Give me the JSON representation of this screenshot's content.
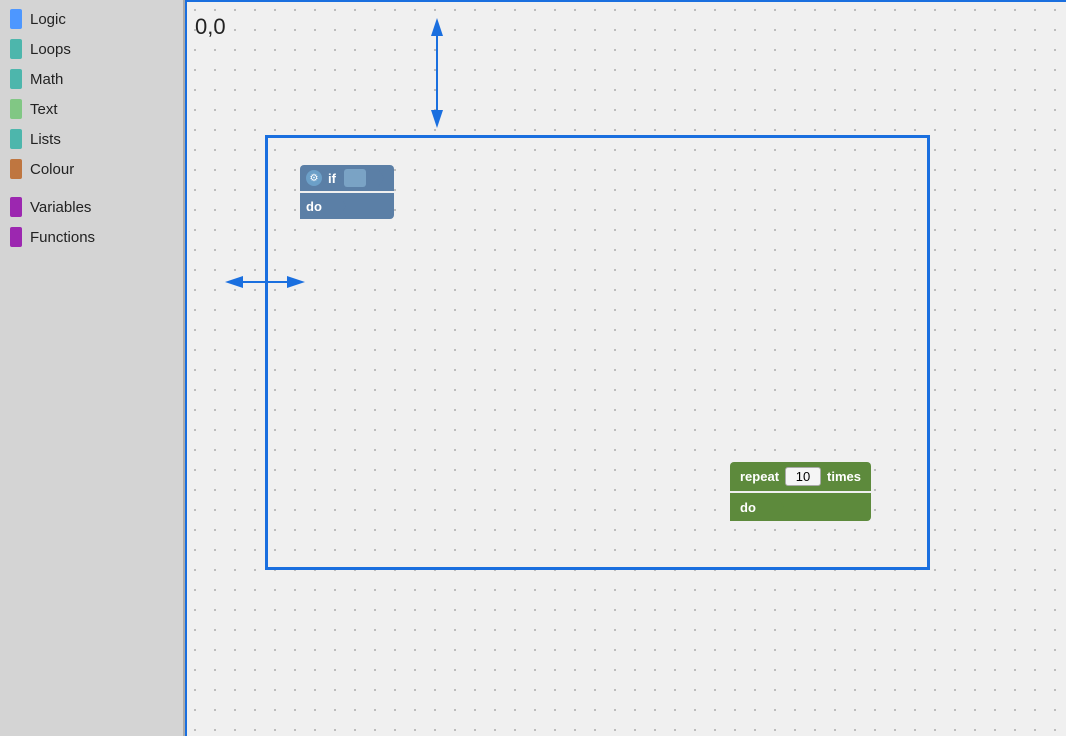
{
  "sidebar": {
    "items": [
      {
        "id": "logic",
        "label": "Logic",
        "color": "#4d97ff"
      },
      {
        "id": "loops",
        "label": "Loops",
        "color": "#4db6ac"
      },
      {
        "id": "math",
        "label": "Math",
        "color": "#4db6ac"
      },
      {
        "id": "text",
        "label": "Text",
        "color": "#81c784"
      },
      {
        "id": "lists",
        "label": "Lists",
        "color": "#4db6ac"
      },
      {
        "id": "colour",
        "label": "Colour",
        "color": "#bf7640"
      },
      {
        "id": "variables",
        "label": "Variables",
        "color": "#9c27b0"
      },
      {
        "id": "functions",
        "label": "Functions",
        "color": "#9c27b0"
      }
    ]
  },
  "canvas": {
    "coord_label": "0,0"
  },
  "block_if": {
    "if_label": "if",
    "do_label": "do"
  },
  "block_repeat": {
    "repeat_label": "repeat",
    "count": "10",
    "times_label": "times",
    "do_label": "do"
  }
}
